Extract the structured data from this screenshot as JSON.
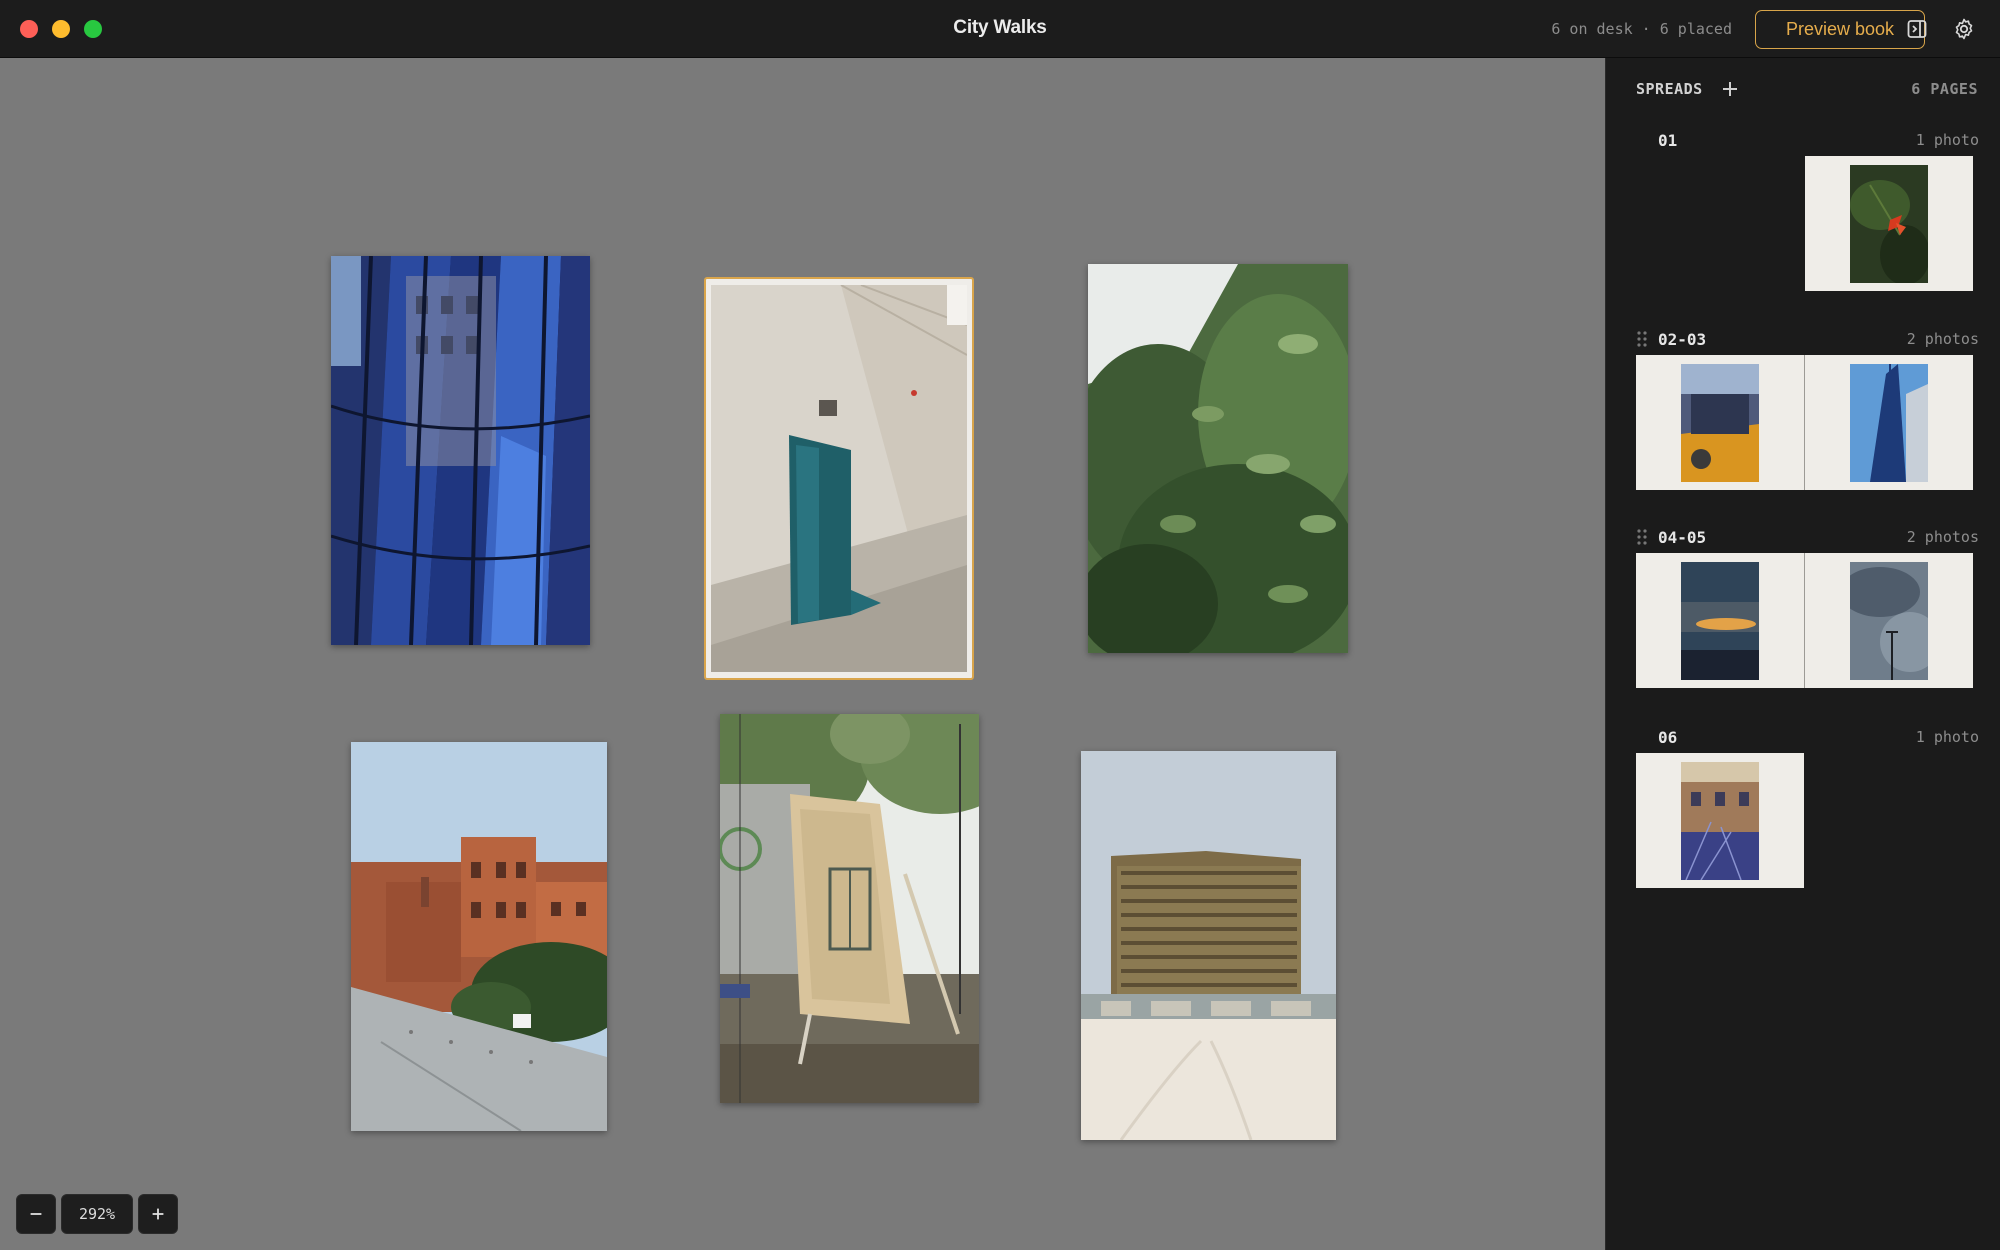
{
  "window": {
    "title": "City Walks",
    "status": "6 on desk · 6 placed",
    "preview_label": "Preview book",
    "accent": "#d9a54c"
  },
  "icons": [
    "close-icon",
    "minimize-icon",
    "maximize-icon",
    "sidebar-toggle-icon",
    "gear-icon",
    "plus-icon",
    "minus-icon",
    "drag-handle-icon"
  ],
  "desk": {
    "photos": [
      {
        "name": "blue-glass-facade",
        "selected": false
      },
      {
        "name": "teal-door-alley",
        "selected": true
      },
      {
        "name": "green-shrub",
        "selected": false
      },
      {
        "name": "brick-tower-rooftop",
        "selected": false
      },
      {
        "name": "wrapped-structure-park",
        "selected": false
      },
      {
        "name": "beach-highrise",
        "selected": false
      }
    ]
  },
  "zoom": {
    "value": "292%"
  },
  "sidebar": {
    "heading": "SPREADS",
    "pages_label": "6 PAGES",
    "spreads": [
      {
        "number": "01",
        "count": "1 photo"
      },
      {
        "number": "02-03",
        "count": "2 photos"
      },
      {
        "number": "04-05",
        "count": "2 photos"
      },
      {
        "number": "06",
        "count": "1 photo"
      }
    ]
  }
}
